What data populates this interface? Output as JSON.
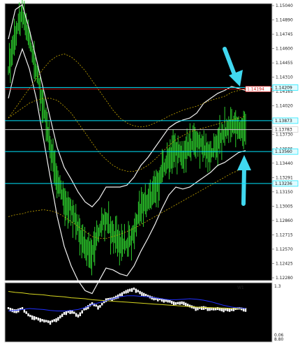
{
  "chart_data": [
    {
      "type": "line",
      "panel": "price",
      "y_axis_ticks": [
        "1.15040",
        "1.14890",
        "1.14745",
        "1.14600",
        "1.14455",
        "1.14310",
        "1.14165",
        "1.14020",
        "1.13875",
        "1.13730",
        "1.13585",
        "1.13440",
        "1.13291",
        "1.13150",
        "1.13005",
        "1.12860",
        "1.12715",
        "1.12570",
        "1.12425",
        "1.12280"
      ],
      "ylim": [
        1.1228,
        1.1504
      ],
      "levels": [
        {
          "value": 1.14209,
          "label": "1.14209",
          "color": "#00e5ff"
        },
        {
          "value": 1.14194,
          "label": "1.14194",
          "color": "#d01010"
        },
        {
          "value": 1.13873,
          "label": "1.13873",
          "color": "#00e5ff"
        },
        {
          "value": 1.13783,
          "label": "1.13783",
          "color": "#c8c8c8"
        },
        {
          "value": 1.1356,
          "label": "1.13560",
          "color": "#00e5ff"
        },
        {
          "value": 1.13236,
          "label": "1.13236",
          "color": "#00e5ff"
        }
      ],
      "series": [
        {
          "values": [
            1.144,
            1.1475,
            1.1495,
            1.147,
            1.144,
            1.14,
            1.136,
            1.133,
            1.1305,
            1.13,
            1.128,
            1.126,
            1.1255,
            1.1275,
            1.129,
            1.127,
            1.1265,
            1.126,
            1.1275,
            1.13,
            1.1305,
            1.1315,
            1.1335,
            1.135,
            1.1358,
            1.135,
            1.1362,
            1.1368,
            1.136,
            1.1352,
            1.1365,
            1.1375,
            1.1385,
            1.1378,
            1.138
          ]
        },
        {
          "values": [
            1.147,
            1.15,
            1.1505,
            1.148,
            1.145,
            1.142,
            1.139,
            1.136,
            1.134,
            1.1328,
            1.1315,
            1.1305,
            1.13,
            1.1308,
            1.132,
            1.132,
            1.132,
            1.1322,
            1.133,
            1.1342,
            1.135,
            1.136,
            1.137,
            1.138,
            1.1385,
            1.1388,
            1.139,
            1.1395,
            1.1405,
            1.141,
            1.1415,
            1.1418,
            1.1422,
            1.142,
            1.1418
          ]
        },
        {
          "values": [
            1.141,
            1.144,
            1.146,
            1.144,
            1.141,
            1.137,
            1.133,
            1.129,
            1.126,
            1.124,
            1.1225,
            1.1215,
            1.1212,
            1.1225,
            1.1238,
            1.1236,
            1.1232,
            1.123,
            1.124,
            1.1255,
            1.1268,
            1.1282,
            1.1298,
            1.1312,
            1.132,
            1.1318,
            1.132,
            1.1325,
            1.133,
            1.1335,
            1.1342,
            1.1345,
            1.135,
            1.1355,
            1.1357
          ]
        },
        {
          "values": [
            1.139,
            1.14,
            1.141,
            1.142,
            1.143,
            1.144,
            1.1448,
            1.1453,
            1.1455,
            1.1452,
            1.1446,
            1.1438,
            1.1428,
            1.1418,
            1.1408,
            1.1398,
            1.139,
            1.1385,
            1.1382,
            1.1381,
            1.1382,
            1.1385,
            1.1388,
            1.1392,
            1.1395,
            1.1398,
            1.14,
            1.1402,
            1.1405,
            1.1408,
            1.141,
            1.1412,
            1.1416,
            1.1418,
            1.142
          ]
        },
        {
          "values": [
            1.139,
            1.1395,
            1.14,
            1.1405,
            1.1408,
            1.141,
            1.141,
            1.1408,
            1.1402,
            1.1395,
            1.1385,
            1.1375,
            1.1365,
            1.1355,
            1.1348,
            1.1342,
            1.1338,
            1.1336,
            1.1336,
            1.1338,
            1.1342,
            1.1348,
            1.1355,
            1.1362,
            1.1368,
            1.1372,
            1.1376,
            1.1378,
            1.138,
            1.1382,
            1.1384,
            1.1386,
            1.1388,
            1.139,
            1.1392
          ]
        },
        {
          "values": [
            1.129,
            1.1292,
            1.1293,
            1.1295,
            1.1296,
            1.1297,
            1.1296,
            1.1294,
            1.129,
            1.1285,
            1.128,
            1.1275,
            1.127,
            1.1268,
            1.1268,
            1.127,
            1.1272,
            1.1275,
            1.1278,
            1.1282,
            1.1286,
            1.129,
            1.1294,
            1.1298,
            1.1302,
            1.1306,
            1.131,
            1.1314,
            1.1318,
            1.1322,
            1.1326,
            1.133,
            1.1334,
            1.1337,
            1.134
          ]
        }
      ],
      "annotations": [
        {
          "type": "arrow",
          "direction": "down",
          "color": "#40d8f0"
        },
        {
          "type": "arrow",
          "direction": "up",
          "color": "#40d8f0"
        }
      ]
    },
    {
      "type": "line",
      "panel": "indicator",
      "label": "W1",
      "y_axis_ticks": [
        "1.3",
        "0.06"
      ],
      "footer": "8.80",
      "series": [
        {
          "values": [
            0.6,
            0.55,
            0.6,
            0.45,
            0.4,
            0.35,
            0.32,
            0.38,
            0.5,
            0.55,
            0.45,
            0.6,
            0.7,
            0.62,
            0.78,
            0.8,
            0.88,
            0.96,
            1.0,
            0.92,
            0.85,
            0.8,
            0.78,
            0.75,
            0.7,
            0.72,
            0.65,
            0.6,
            0.62,
            0.58,
            0.6,
            0.57,
            0.58,
            0.6,
            0.58
          ]
        },
        {
          "values": [
            0.95,
            0.93,
            0.92,
            0.9,
            0.89,
            0.88,
            0.86,
            0.85,
            0.84,
            0.82,
            0.81,
            0.8,
            0.78,
            0.77,
            0.76,
            0.75,
            0.74,
            0.73,
            0.72,
            0.71,
            0.7,
            0.69,
            0.68,
            0.67,
            0.66,
            0.65,
            0.64,
            0.63,
            0.62,
            0.62,
            0.61,
            0.61,
            0.6,
            0.6,
            0.6
          ]
        },
        {
          "values": [
            0.55,
            0.56,
            0.58,
            0.6,
            0.59,
            0.58,
            0.56,
            0.55,
            0.55,
            0.56,
            0.58,
            0.62,
            0.68,
            0.72,
            0.76,
            0.8,
            0.84,
            0.86,
            0.86,
            0.85,
            0.84,
            0.82,
            0.8,
            0.78,
            0.78,
            0.79,
            0.8,
            0.79,
            0.77,
            0.74,
            0.7,
            0.66,
            0.63,
            0.61,
            0.6
          ]
        }
      ]
    }
  ],
  "style": {
    "panel_bg": "#000000",
    "border": "#c8c8c8",
    "candle_color": "#2ccc2c",
    "band_color": "#f2f2f2",
    "ma_color": "#c8a800",
    "ind_bar_color": "#ffffff",
    "ind_yellow": "#d8d820",
    "ind_blue": "#2030ff",
    "ind_label_color": "#2f7d2f"
  }
}
